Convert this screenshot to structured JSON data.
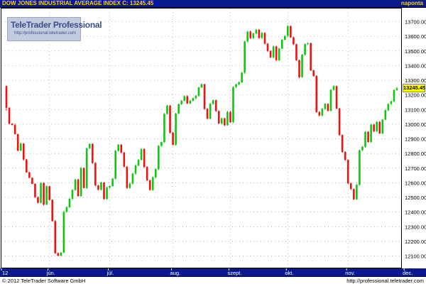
{
  "header": {
    "title": "DOW JONES INDUSTRIAL AVERAGE INDEX C: 13245.45",
    "period": "naponta"
  },
  "logo": {
    "brand": "TeleTrader Professional",
    "url": "http://professional.teletrader.com"
  },
  "footer": {
    "copyright": "© 2012 TeleTrader Software GmbH",
    "website": "http://professional.teletrader.com"
  },
  "colors": {
    "background": "#ffffff",
    "bar": "#0a1a8c",
    "axis_text": "#ffffff",
    "title_text": "#ffd400",
    "up_candle": "#11c611",
    "down_candle": "#ee1111",
    "grid": "#9a9a9a",
    "last_price_box": "#ffff00"
  },
  "chart_data": {
    "type": "candlestick",
    "title": "DOW JONES INDUSTRIAL AVERAGE INDEX",
    "last_close": 13245.45,
    "last_close_label": "13245.45",
    "ylim": [
      12020,
      13790
    ],
    "yticks": [
      12100,
      12200,
      12300,
      12400,
      12500,
      12600,
      12700,
      12800,
      12900,
      13000,
      13100,
      13200,
      13300,
      13400,
      13500,
      13600,
      13700
    ],
    "ytick_labels": [
      "12100.00",
      "12200.00",
      "12300.00",
      "12400.00",
      "12500.00",
      "12600.00",
      "12700.00",
      "12800.00",
      "12900.00",
      "13000.00",
      "13100.00",
      "13200.00",
      "13300.00",
      "13400.00",
      "13500.00",
      "13600.00",
      "13700.00"
    ],
    "xtick_labels": [
      "12",
      "jún.",
      "júl.",
      "aug.",
      "szept.",
      "okt.",
      "nov.",
      "dec."
    ],
    "xtick_index": [
      0,
      15,
      36,
      58,
      78,
      98,
      119,
      139
    ],
    "grid": true,
    "candles": [
      [
        13260,
        13264,
        13091,
        13112
      ],
      [
        13112,
        13115,
        13000,
        13003
      ],
      [
        13003,
        13007,
        12993,
        12994
      ],
      [
        12994,
        13003,
        12930,
        12932
      ],
      [
        12932,
        12935,
        12815,
        12820
      ],
      [
        12820,
        12874,
        12816,
        12868
      ],
      [
        12868,
        12871,
        12751,
        12759
      ],
      [
        12759,
        12763,
        12669,
        12671
      ],
      [
        12671,
        12676,
        12630,
        12634
      ],
      [
        12634,
        12637,
        12591,
        12592
      ],
      [
        12592,
        12596,
        12496,
        12502
      ],
      [
        12502,
        12506,
        12459,
        12463
      ],
      [
        12463,
        12604,
        12459,
        12598
      ],
      [
        12598,
        12603,
        12444,
        12451
      ],
      [
        12451,
        12582,
        12447,
        12576
      ],
      [
        12576,
        12579,
        12479,
        12483
      ],
      [
        12483,
        12487,
        12336,
        12338
      ],
      [
        12338,
        12346,
        12115,
        12119
      ],
      [
        12119,
        12124,
        12099,
        12101
      ],
      [
        12101,
        12128,
        12100,
        12123
      ],
      [
        12123,
        12409,
        12119,
        12401
      ],
      [
        12401,
        12439,
        12397,
        12433
      ],
      [
        12433,
        12495,
        12428,
        12490
      ],
      [
        12490,
        12555,
        12483,
        12551
      ],
      [
        12551,
        12626,
        12544,
        12622
      ],
      [
        12622,
        12627,
        12505,
        12509
      ],
      [
        12509,
        12708,
        12505,
        12700
      ],
      [
        12700,
        12705,
        12562,
        12564
      ],
      [
        12564,
        12841,
        12559,
        12835
      ],
      [
        12835,
        12869,
        12831,
        12865
      ],
      [
        12865,
        12869,
        12729,
        12735
      ],
      [
        12735,
        12741,
        12576,
        12582
      ],
      [
        12582,
        12586,
        12549,
        12552
      ],
      [
        12552,
        12608,
        12546,
        12602
      ],
      [
        12602,
        12605,
        12484,
        12489
      ],
      [
        12489,
        12574,
        12485,
        12567
      ],
      [
        12567,
        12582,
        12560,
        12577
      ],
      [
        12577,
        12633,
        12573,
        12628
      ],
      [
        12628,
        12824,
        12622,
        12818
      ],
      [
        12818,
        12864,
        12812,
        12860
      ],
      [
        12860,
        12864,
        12801,
        12806
      ],
      [
        12806,
        12812,
        12704,
        12710
      ],
      [
        12710,
        12713,
        12558,
        12565
      ],
      [
        12565,
        12601,
        12559,
        12594
      ],
      [
        12594,
        12667,
        12589,
        12663
      ],
      [
        12663,
        12725,
        12655,
        12718
      ],
      [
        12718,
        12762,
        12713,
        12756
      ],
      [
        12756,
        12835,
        12751,
        12830
      ],
      [
        12830,
        12835,
        12702,
        12708
      ],
      [
        12708,
        12713,
        12612,
        12617
      ],
      [
        12617,
        12621,
        12546,
        12551
      ],
      [
        12551,
        12644,
        12544,
        12637
      ],
      [
        12637,
        12699,
        12630,
        12693
      ],
      [
        12693,
        12857,
        12686,
        12852
      ],
      [
        12852,
        12882,
        12846,
        12878
      ],
      [
        12878,
        13076,
        12872,
        13070
      ],
      [
        13070,
        13132,
        13065,
        13127
      ],
      [
        13127,
        13131,
        12936,
        12942
      ],
      [
        12942,
        12947,
        12856,
        12859
      ],
      [
        12859,
        13078,
        12853,
        13073
      ],
      [
        13073,
        13142,
        13068,
        13137
      ],
      [
        13137,
        13166,
        13132,
        13160
      ],
      [
        13160,
        13197,
        13156,
        13191
      ],
      [
        13191,
        13198,
        13138,
        13141
      ],
      [
        13141,
        13167,
        13137,
        13160
      ],
      [
        13160,
        13182,
        13155,
        13177
      ],
      [
        13177,
        13200,
        13171,
        13194
      ],
      [
        13194,
        13256,
        13189,
        13251
      ],
      [
        13251,
        13279,
        13247,
        13273
      ],
      [
        13273,
        13276,
        13098,
        13105
      ],
      [
        13105,
        13110,
        13032,
        13038
      ],
      [
        13038,
        13145,
        13033,
        13139
      ],
      [
        13139,
        13168,
        13133,
        13164
      ],
      [
        13164,
        13168,
        13084,
        13090
      ],
      [
        13090,
        13094,
        13002,
        13005
      ],
      [
        13005,
        13045,
        12997,
        13040
      ],
      [
        13040,
        13044,
        12987,
        12993
      ],
      [
        12993,
        13091,
        12990,
        13083
      ],
      [
        13083,
        13091,
        13008,
        13014
      ],
      [
        13014,
        13259,
        13008,
        13254
      ],
      [
        13254,
        13278,
        13247,
        13272
      ],
      [
        13272,
        13292,
        13267,
        13286
      ],
      [
        13286,
        13358,
        13281,
        13352
      ],
      [
        13352,
        13570,
        13345,
        13565
      ],
      [
        13565,
        13637,
        13559,
        13632
      ],
      [
        13632,
        13640,
        13581,
        13588
      ],
      [
        13588,
        13625,
        13583,
        13620
      ],
      [
        13620,
        13651,
        13613,
        13645
      ],
      [
        13645,
        13651,
        13583,
        13589
      ],
      [
        13589,
        13630,
        13583,
        13623
      ],
      [
        13623,
        13629,
        13546,
        13550
      ],
      [
        13550,
        13554,
        13494,
        13500
      ],
      [
        13500,
        13505,
        13452,
        13456
      ],
      [
        13456,
        13537,
        13450,
        13531
      ],
      [
        13531,
        13536,
        13431,
        13437
      ],
      [
        13437,
        13522,
        13430,
        13516
      ],
      [
        13516,
        13582,
        13512,
        13577
      ],
      [
        13577,
        13608,
        13572,
        13602
      ],
      [
        13602,
        13676,
        13597,
        13670
      ],
      [
        13670,
        13674,
        13589,
        13593
      ],
      [
        13593,
        13598,
        13541,
        13546
      ],
      [
        13546,
        13550,
        13432,
        13437
      ],
      [
        13437,
        13441,
        13315,
        13321
      ],
      [
        13321,
        13480,
        13317,
        13475
      ],
      [
        13475,
        13552,
        13468,
        13547
      ],
      [
        13547,
        13558,
        13541,
        13553
      ],
      [
        13553,
        13558,
        13363,
        13368
      ],
      [
        13368,
        13372,
        13325,
        13329
      ],
      [
        13329,
        13335,
        13078,
        13083
      ],
      [
        13083,
        13089,
        13053,
        13059
      ],
      [
        13059,
        13111,
        13053,
        13104
      ],
      [
        13104,
        13145,
        13100,
        13139
      ],
      [
        13139,
        13143,
        13086,
        13092
      ],
      [
        13092,
        13240,
        13086,
        13235
      ],
      [
        13235,
        13265,
        13230,
        13260
      ],
      [
        13260,
        13264,
        13102,
        13107
      ],
      [
        13107,
        13112,
        12920,
        12926
      ],
      [
        12926,
        12930,
        12805,
        12810
      ],
      [
        12810,
        12815,
        12750,
        12756
      ],
      [
        12756,
        12760,
        12590,
        12596
      ],
      [
        12596,
        12601,
        12551,
        12557
      ],
      [
        12557,
        12561,
        12482,
        12487
      ],
      [
        12487,
        12593,
        12482,
        12586
      ],
      [
        12586,
        12826,
        12580,
        12822
      ],
      [
        12822,
        12851,
        12816,
        12846
      ],
      [
        12846,
        12953,
        12840,
        12948
      ],
      [
        12948,
        12952,
        12874,
        12878
      ],
      [
        12878,
        13002,
        12873,
        12997
      ],
      [
        12997,
        13002,
        12946,
        12952
      ],
      [
        12952,
        13021,
        12946,
        13016
      ],
      [
        13016,
        13021,
        12933,
        12937
      ],
      [
        12937,
        13036,
        12931,
        13031
      ],
      [
        13031,
        13101,
        13027,
        13095
      ],
      [
        13095,
        13143,
        13089,
        13138
      ],
      [
        13138,
        13161,
        13132,
        13156
      ],
      [
        13156,
        13238,
        13150,
        13233
      ],
      [
        13233,
        13254,
        13228,
        13245
      ]
    ]
  }
}
